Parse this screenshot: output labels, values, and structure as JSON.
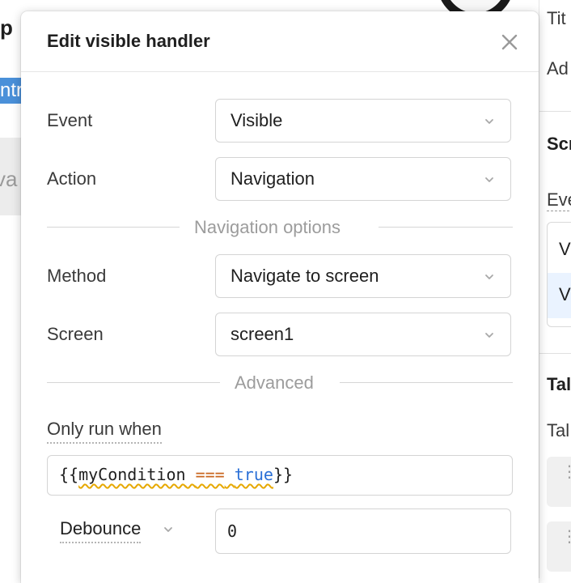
{
  "background": {
    "left_title_fragment": "p",
    "left_selected_fragment": "ntr",
    "left_grey_fragment": "va",
    "right_panel": {
      "title_label": "Tit",
      "add_label": "Ad",
      "section_label": "Scr",
      "events_label": "Eve",
      "event_rows": [
        "V",
        "V"
      ],
      "table_section_label": "Tal",
      "table_label": "Tal",
      "handle_glyph": "⋮"
    }
  },
  "dialog": {
    "title": "Edit visible handler",
    "close_icon": "close-icon",
    "fields": {
      "event": {
        "label": "Event",
        "value": "Visible"
      },
      "action": {
        "label": "Action",
        "value": "Navigation"
      },
      "method": {
        "label": "Method",
        "value": "Navigate to screen"
      },
      "screen": {
        "label": "Screen",
        "value": "screen1"
      }
    },
    "sections": {
      "navigation_options": "Navigation options",
      "advanced": "Advanced"
    },
    "only_run_when": {
      "label": "Only run when",
      "code": {
        "open": "{{",
        "identifier": "myCondition",
        "operator": "===",
        "keyword": "true",
        "close": "}}"
      }
    },
    "debounce": {
      "label": "Debounce",
      "value": "0"
    }
  },
  "colors": {
    "accent_blue": "#2a6fd6",
    "operator_orange": "#c9651e",
    "warning_underline": "#e6a800",
    "selection_blue": "#4a90d9"
  }
}
